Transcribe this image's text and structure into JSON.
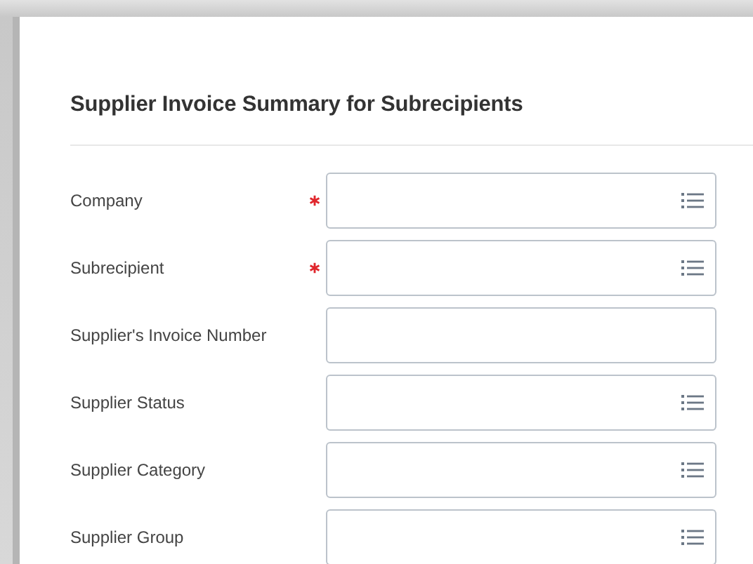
{
  "title": "Supplier Invoice Summary for Subrecipients",
  "fields": [
    {
      "label": "Company",
      "required": true,
      "kind": "prompt"
    },
    {
      "label": "Subrecipient",
      "required": true,
      "kind": "prompt"
    },
    {
      "label": "Supplier's Invoice Number",
      "required": false,
      "kind": "text"
    },
    {
      "label": "Supplier Status",
      "required": false,
      "kind": "prompt"
    },
    {
      "label": "Supplier Category",
      "required": false,
      "kind": "prompt"
    },
    {
      "label": "Supplier Group",
      "required": false,
      "kind": "prompt"
    }
  ]
}
